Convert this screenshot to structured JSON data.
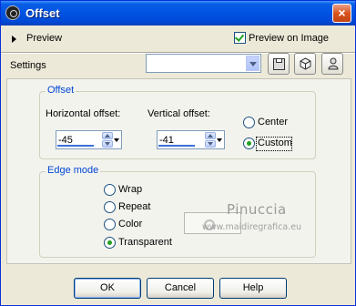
{
  "window": {
    "title": "Offset",
    "close_glyph": "×"
  },
  "preview": {
    "label": "Preview",
    "preview_on_image_label": "Preview on Image",
    "preview_on_image_checked": true
  },
  "settings": {
    "label": "Settings",
    "preset_value": ""
  },
  "offset": {
    "group_title": "Offset",
    "horizontal_label": "Horizontal offset:",
    "horizontal_value": "-45",
    "vertical_label": "Vertical offset:",
    "vertical_value": "-41",
    "center_label": "Center",
    "custom_label": "Custom",
    "selected": "Custom"
  },
  "edge_mode": {
    "group_title": "Edge mode",
    "options": [
      "Wrap",
      "Repeat",
      "Color",
      "Transparent"
    ],
    "selected": "Transparent"
  },
  "watermark": {
    "name": "Pinuccia",
    "url": "www.maidiregrafica.eu"
  },
  "buttons": {
    "ok": "OK",
    "cancel": "Cancel",
    "help": "Help"
  },
  "colors": {
    "title_bar": "#0054e3",
    "group_title": "#0046d5",
    "radio_check": "#21a121"
  },
  "icons": [
    "app-icon",
    "close-icon",
    "expand-triangle-icon",
    "dropdown-arrow-icon",
    "save-preset-icon",
    "cube-icon",
    "reset-icon",
    "spin-up-icon",
    "spin-down-icon"
  ]
}
